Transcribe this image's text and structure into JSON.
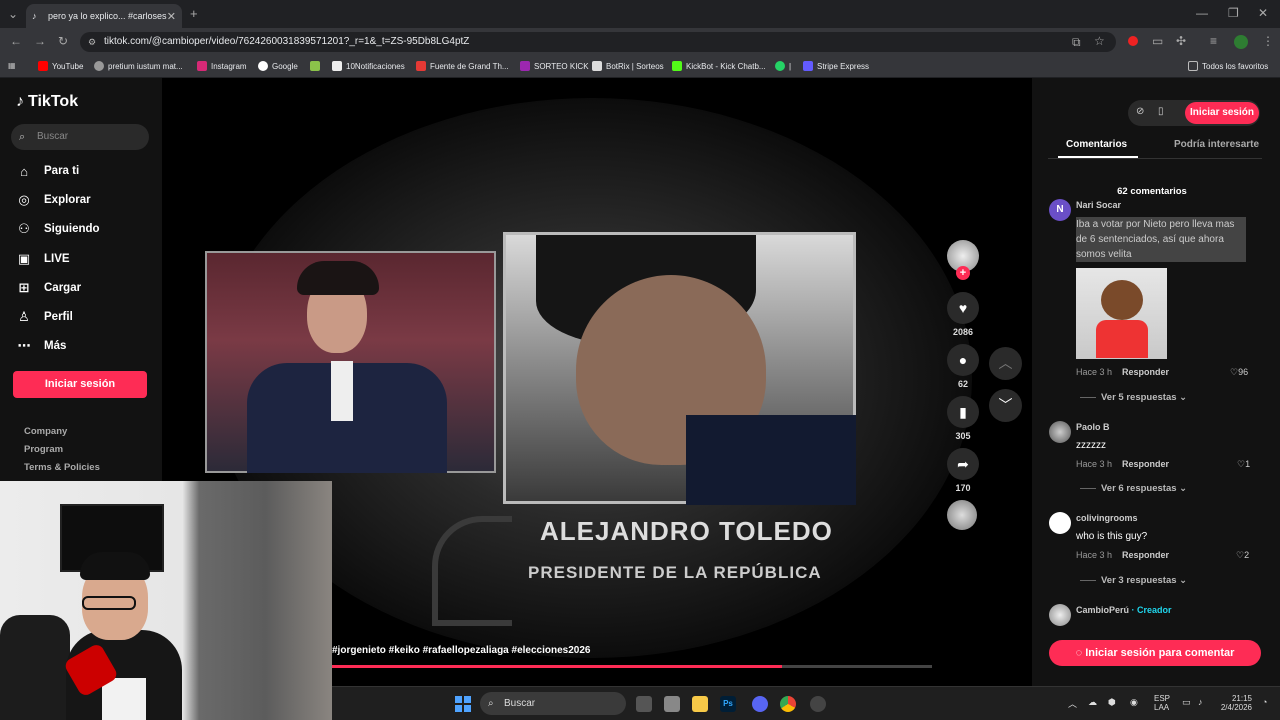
{
  "browser": {
    "tab_title": "pero ya lo explico... #carlosesp",
    "url": "tiktok.com/@cambioper/video/7624260031839571201?_r=1&_t=ZS-95Db8LG4ptZ",
    "bookmarks": [
      "YouTube",
      "pretium iustum mat...",
      "Instagram",
      "Google",
      "10Notificaciones",
      "Fuente de Grand Th...",
      "SORTEO KICK",
      "BotRix | Sorteos",
      "KickBot - Kick Chatb...",
      "|",
      "Stripe Express"
    ],
    "all_bookmarks": "Todos los favoritos"
  },
  "sidebar": {
    "logo": "TikTok",
    "search_placeholder": "Buscar",
    "nav": [
      {
        "label": "Para ti",
        "icon": "home-icon"
      },
      {
        "label": "Explorar",
        "icon": "compass-icon"
      },
      {
        "label": "Siguiendo",
        "icon": "people-icon"
      },
      {
        "label": "LIVE",
        "icon": "live-icon"
      },
      {
        "label": "Cargar",
        "icon": "plus-box-icon"
      },
      {
        "label": "Perfil",
        "icon": "user-icon"
      },
      {
        "label": "Más",
        "icon": "more-icon"
      }
    ],
    "login": "Iniciar sesión",
    "footer": [
      "Company",
      "Program",
      "Terms & Policies"
    ]
  },
  "video": {
    "caption_name": "ALEJANDRO TOLEDO",
    "caption_title": "PRESIDENTE DE LA REPÚBLICA",
    "hashtags": "#jorgenieto #keiko #rafaellopezaliaga #elecciones2026",
    "progress": 0.75,
    "likes": "2086",
    "comments": "62",
    "saves": "305",
    "shares": "170"
  },
  "panel": {
    "login": "Iniciar sesión",
    "tabs": [
      "Comentarios",
      "Podría interesarte"
    ],
    "comment_count": "62 comentarios",
    "comments": [
      {
        "name": "Nari Socar",
        "text": "Iba a votar por Nieto pero lleva mas de 6 sentenciados, así que ahora somos velita",
        "time": "Hace 3 h",
        "reply": "Responder",
        "likes": "96",
        "replies": "Ver 5 respuestas",
        "avatar_letter": "N"
      },
      {
        "name": "Paolo B",
        "text": "zzzzzz",
        "time": "Hace 3 h",
        "reply": "Responder",
        "likes": "1",
        "replies": "Ver 6 respuestas"
      },
      {
        "name": "colivingrooms",
        "text": "who is this guy?",
        "time": "Hace 3 h",
        "reply": "Responder",
        "likes": "2",
        "replies": "Ver 3 respuestas"
      },
      {
        "name": "CambioPerú",
        "creator": "· Creador"
      }
    ],
    "comment_button": "Iniciar sesión para comentar"
  },
  "taskbar": {
    "search": "Buscar",
    "lang": "ESP",
    "lang2": "LAA",
    "time": "21:15",
    "date": "2/4/2026"
  }
}
